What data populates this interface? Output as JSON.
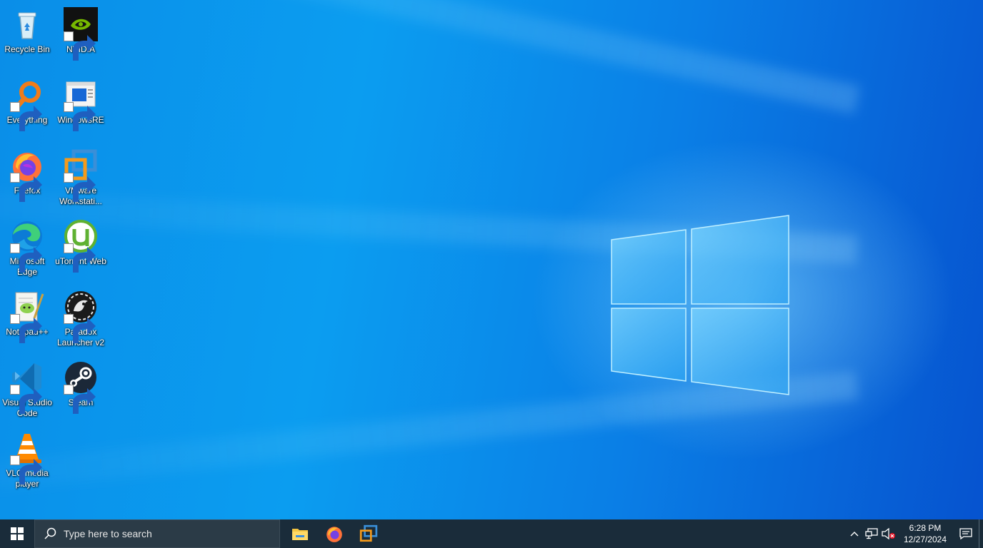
{
  "desktop": {
    "icons": [
      {
        "label": "Recycle Bin",
        "icon": "recycle-bin-icon"
      },
      {
        "label": "NVIDIA",
        "icon": "nvidia-icon"
      },
      {
        "label": "Everything",
        "icon": "everything-search-icon"
      },
      {
        "label": "WindowsRE",
        "icon": "windowsre-icon"
      },
      {
        "label": "Firefox",
        "icon": "firefox-icon"
      },
      {
        "label": "VMware Workstati...",
        "icon": "vmware-icon"
      },
      {
        "label": "Microsoft Edge",
        "icon": "edge-icon"
      },
      {
        "label": "uTorrent Web",
        "icon": "utorrent-icon"
      },
      {
        "label": "Notepad++",
        "icon": "notepad-plus-plus-icon"
      },
      {
        "label": "Paradox Launcher v2",
        "icon": "paradox-icon"
      },
      {
        "label": "Visual Studio Code",
        "icon": "vscode-icon"
      },
      {
        "label": "Steam",
        "icon": "steam-icon"
      },
      {
        "label": "VLC media player",
        "icon": "vlc-icon"
      }
    ]
  },
  "taskbar": {
    "search_placeholder": "Type here to search",
    "pinned_apps": [
      "file-explorer-icon",
      "firefox-icon",
      "vmware-icon"
    ],
    "clock": {
      "time": "6:28 PM",
      "date": "12/27/2024"
    }
  },
  "colors": {
    "taskbar_bg": "#1a2c3a",
    "desktop_blue": "#0a8ee8"
  }
}
